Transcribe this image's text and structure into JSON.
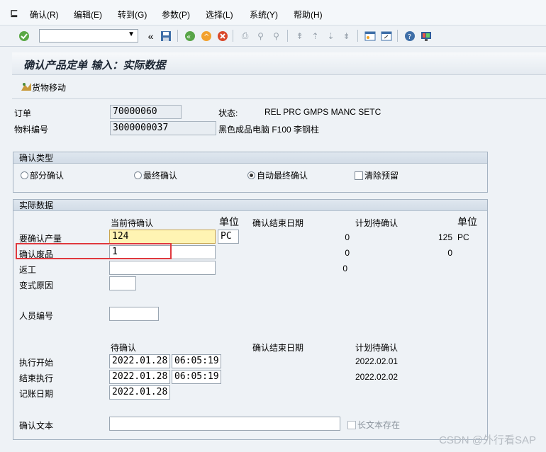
{
  "menu": {
    "items": [
      "确认(R)",
      "编辑(E)",
      "转到(G)",
      "参数(P)",
      "选择(L)",
      "系统(Y)",
      "帮助(H)"
    ]
  },
  "toolbar": {
    "command_field_value": "",
    "icons": [
      "enter-check-icon",
      "command-dropdown-icon",
      "collapse-icon",
      "save-icon",
      "back-icon",
      "exit-icon",
      "cancel-icon",
      "print-icon",
      "find-icon",
      "find-next-icon",
      "first-page-icon",
      "previous-page-icon",
      "next-page-icon",
      "last-page-icon",
      "new-session-icon",
      "shortcut-icon",
      "help-icon",
      "layout-icon"
    ]
  },
  "title": "确认产品定单 输入：实际数据",
  "app_toolbar": {
    "goods_movement_label": "货物移动"
  },
  "header": {
    "order_label": "订单",
    "order_value": "70000060",
    "status_label": "状态:",
    "status_value": "REL  PRC  GMPS MANC SETC",
    "material_label": "物料编号",
    "material_value": "3000000037",
    "material_desc": "黑色成品电脑 F100 李钢柱"
  },
  "confirm_type": {
    "title": "确认类型",
    "options": [
      {
        "label": "部分确认",
        "selected": false
      },
      {
        "label": "最终确认",
        "selected": false
      },
      {
        "label": "自动最终确认",
        "selected": true
      }
    ],
    "clear_reservation_label": "清除预留",
    "clear_reservation_checked": false
  },
  "actual": {
    "title": "实际数据",
    "col_current": "当前待确认",
    "col_unit": "单位",
    "col_end_date": "确认结束日期",
    "col_planned": "计划待确认",
    "col_unit2": "单位",
    "yield_label": "要确认产量",
    "yield_value": "124",
    "yield_unit": "PC",
    "yield_end": "0",
    "yield_planned": "125",
    "yield_planned_unit": "PC",
    "scrap_label": "确认废品",
    "scrap_value": "1",
    "scrap_end": "0",
    "scrap_planned": "0",
    "rework_label": "返工",
    "rework_value": "",
    "rework_end": "0",
    "variance_label": "变式原因",
    "variance_value": "",
    "personnel_label": "人员编号",
    "personnel_value": "",
    "col2_to_confirm": "待确认",
    "col2_end_date": "确认结束日期",
    "col2_planned": "计划待确认",
    "exec_start_label": "执行开始",
    "exec_start_date": "2022.01.28",
    "exec_start_time": "06:05:19",
    "exec_start_planned": "2022.02.01",
    "exec_end_label": "结束执行",
    "exec_end_date": "2022.01.28",
    "exec_end_time": "06:05:19",
    "exec_end_planned": "2022.02.02",
    "posting_label": "记账日期",
    "posting_date": "2022.01.28",
    "text_label": "确认文本",
    "text_value": "",
    "long_text_label": "长文本存在",
    "long_text_checked": false
  },
  "watermark": "CSDN @外行看SAP",
  "colors": {
    "highlight": "#e0393e",
    "active_field": "#fff4b3"
  }
}
